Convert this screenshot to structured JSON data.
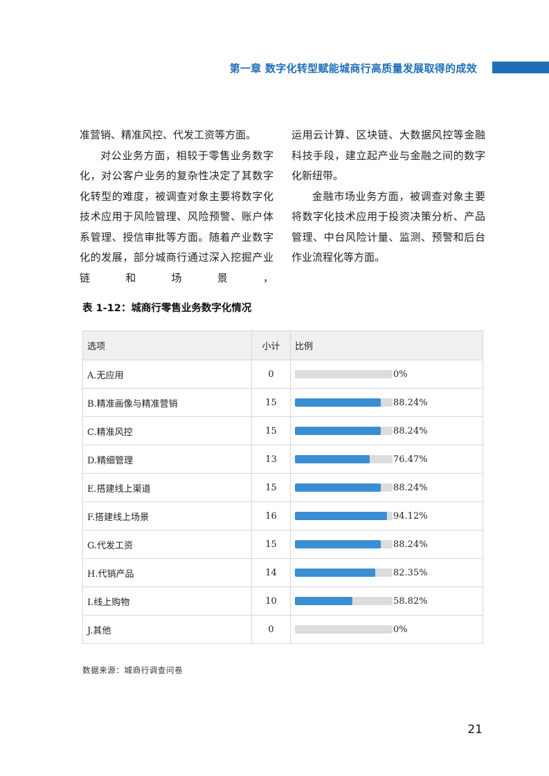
{
  "header": {
    "title": "第一章  数字化转型赋能城商行高质量发展取得的成效",
    "accent_color": "#1e6fb8"
  },
  "body_text": {
    "left": [
      "准营销、精准风控、代发工资等方面。",
      "对公业务方面，相较于零售业务数字化，对公客户业务的复杂性决定了其数字化转型的难度，被调查对象主要将数字化技术应用于风险管理、风险预警、账户体系管理、授信审批等方面。随着产业数字化的发展，部分城商行通过深入挖掘产业链和场景，"
    ],
    "right": [
      "运用云计算、区块链、大数据风控等金融科技手段，建立起产业与金融之间的数字化新纽带。",
      "金融市场业务方面，被调查对象主要将数字化技术应用于投资决策分析、产品管理、中台风险计量、监测、预警和后台作业流程化等方面。"
    ]
  },
  "table": {
    "title": "表 1-12：城商行零售业务数字化情况",
    "headers": {
      "option": "选项",
      "count": "小计",
      "ratio": "比例"
    },
    "rows": [
      {
        "option": "A.无应用",
        "count": "0",
        "pct": "0%",
        "ratio": 0
      },
      {
        "option": "B.精准画像与精准营销",
        "count": "15",
        "pct": "88.24%",
        "ratio": 0.8824
      },
      {
        "option": "C.精准风控",
        "count": "15",
        "pct": "88.24%",
        "ratio": 0.8824
      },
      {
        "option": "D.精细管理",
        "count": "13",
        "pct": "76.47%",
        "ratio": 0.7647
      },
      {
        "option": "E.搭建线上渠道",
        "count": "15",
        "pct": "88.24%",
        "ratio": 0.8824
      },
      {
        "option": "F.搭建线上场景",
        "count": "16",
        "pct": "94.12%",
        "ratio": 0.9412
      },
      {
        "option": "G.代发工资",
        "count": "15",
        "pct": "88.24%",
        "ratio": 0.8824
      },
      {
        "option": "H.代销产品",
        "count": "14",
        "pct": "82.35%",
        "ratio": 0.8235
      },
      {
        "option": "I.线上购物",
        "count": "10",
        "pct": "58.82%",
        "ratio": 0.5882
      },
      {
        "option": "J.其他",
        "count": "0",
        "pct": "0%",
        "ratio": 0
      }
    ],
    "bar_color": "#3a8ed3",
    "track_color": "#dcdcdc"
  },
  "source": "数据来源：城商行调查问卷",
  "page_number": "21"
}
